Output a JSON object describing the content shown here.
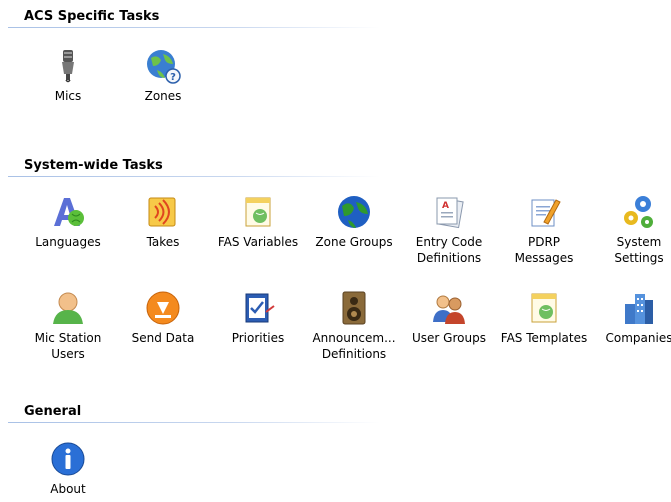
{
  "sections": {
    "acs": {
      "title": "ACS Specific Tasks",
      "items": {
        "mics": "Mics",
        "zones": "Zones"
      }
    },
    "system": {
      "title": "System-wide Tasks",
      "items": {
        "languages": "Languages",
        "takes": "Takes",
        "fas_variables": "FAS Variables",
        "zone_groups": "Zone Groups",
        "entry_code": "Entry Code\nDefinitions",
        "pdrp": "PDRP\nMessages",
        "system_settings": "System\nSettings",
        "mic_station_users": "Mic Station\nUsers",
        "send_data": "Send Data",
        "priorities": "Priorities",
        "announcements": "Announcem...\nDefinitions",
        "user_groups": "User Groups",
        "fas_templates": "FAS Templates",
        "companies": "Companies"
      }
    },
    "general": {
      "title": "General",
      "items": {
        "about": "About"
      }
    }
  }
}
